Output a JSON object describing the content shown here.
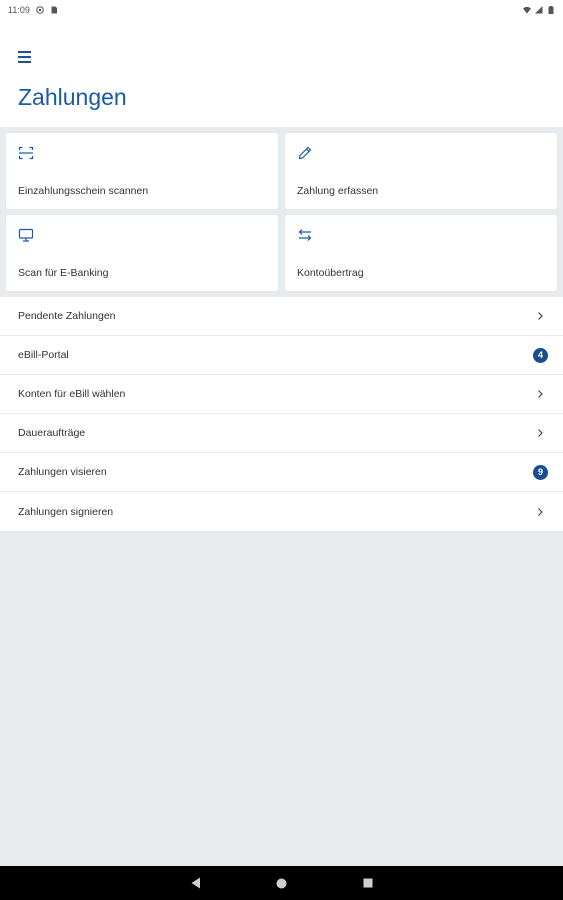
{
  "status_bar": {
    "time": "11:09"
  },
  "header": {
    "title": "Zahlungen"
  },
  "tiles": [
    {
      "label": "Einzahlungsschein scannen",
      "icon": "scan-icon"
    },
    {
      "label": "Zahlung erfassen",
      "icon": "pencil-icon"
    },
    {
      "label": "Scan für E-Banking",
      "icon": "monitor-icon"
    },
    {
      "label": "Kontoübertrag",
      "icon": "transfer-icon"
    }
  ],
  "list": [
    {
      "label": "Pendente Zahlungen"
    },
    {
      "label": "eBill-Portal",
      "badge": "4"
    },
    {
      "label": "Konten für eBill wählen"
    },
    {
      "label": "Daueraufträge"
    },
    {
      "label": "Zahlungen visieren",
      "badge": "9"
    },
    {
      "label": "Zahlungen signieren"
    }
  ],
  "colors": {
    "accent": "#1a5aa6",
    "badge": "#1a4d8f",
    "background": "#e8ebee"
  }
}
